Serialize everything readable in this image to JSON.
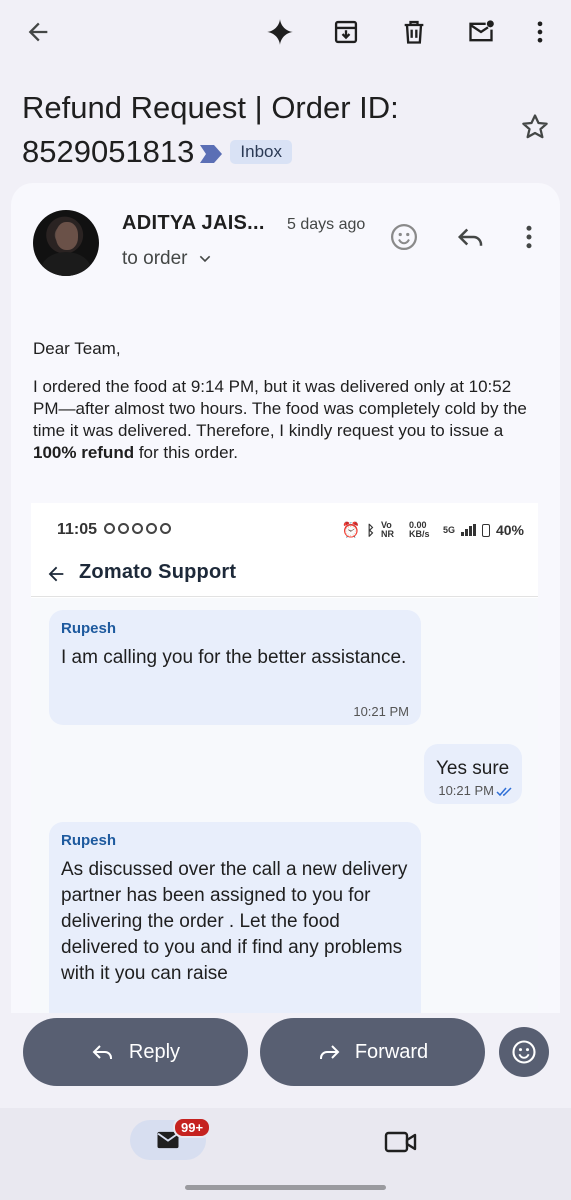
{
  "subject": {
    "text": "Refund Request | Order ID: 8529051813",
    "label": "Inbox"
  },
  "message": {
    "sender": "ADITYA JAIS...",
    "time": "5 days ago",
    "to": "to order",
    "greeting": "Dear Team,",
    "body_part1": "I ordered the food at 9:14 PM, but it was delivered only at 10:52 PM—after almost two hours. The food was completely cold by the time it was delivered. Therefore, I kindly request you to issue a ",
    "body_bold": "100% refund",
    "body_part2": " for this order."
  },
  "attachment": {
    "status_time": "11:05",
    "status_vo": "Vo NR",
    "status_speed": "0.00 KB/s",
    "status_net": "5G",
    "status_battery": "40%",
    "title": "Zomato Support",
    "messages": [
      {
        "from": "Rupesh",
        "text": "I am calling you for the better assistance.",
        "time": "10:21 PM"
      },
      {
        "text": "Yes sure",
        "time": "10:21 PM"
      },
      {
        "from": "Rupesh",
        "text": "As discussed over the call a new delivery partner has been assigned to you for delivering the order . Let the food delivered to you and if find any problems with it you can raise"
      }
    ]
  },
  "actions": {
    "reply": "Reply",
    "forward": "Forward"
  },
  "nav": {
    "badge": "99+"
  }
}
